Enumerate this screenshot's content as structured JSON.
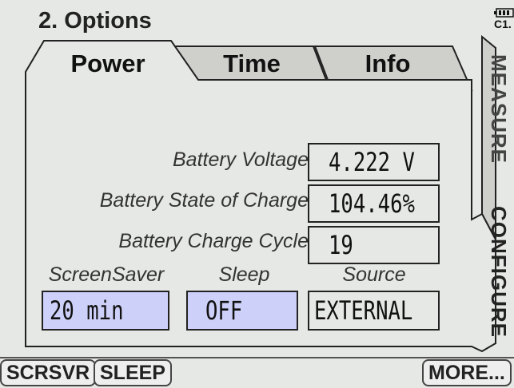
{
  "header": {
    "title": "2. Options",
    "channel": "C1."
  },
  "tabs": [
    {
      "label": "Power",
      "active": true
    },
    {
      "label": "Time",
      "active": false
    },
    {
      "label": "Info",
      "active": false
    }
  ],
  "rows": [
    {
      "label": "Battery Voltage",
      "value": "4.222 V"
    },
    {
      "label": "Battery State of Charge",
      "value": "104.46%"
    },
    {
      "label": "Battery Charge Cycle",
      "value": "19"
    }
  ],
  "options": [
    {
      "label": "ScreenSaver",
      "value": "20 min",
      "editable": true
    },
    {
      "label": "Sleep",
      "value": "OFF",
      "editable": true
    },
    {
      "label": "Source",
      "value": "EXTERNAL",
      "editable": false
    }
  ],
  "side_tabs": [
    {
      "label": "MEASURE",
      "active": false
    },
    {
      "label": "CONFIGURE",
      "active": true
    }
  ],
  "softkeys": {
    "scrsvr": "SCRSVR",
    "sleep": "SLEEP",
    "more": "MORE..."
  },
  "colors": {
    "screen_bg": "#e6e8e5",
    "inactive_tab": "#cfd0cc",
    "highlight": "#cdd0f8",
    "text": "#111111"
  }
}
